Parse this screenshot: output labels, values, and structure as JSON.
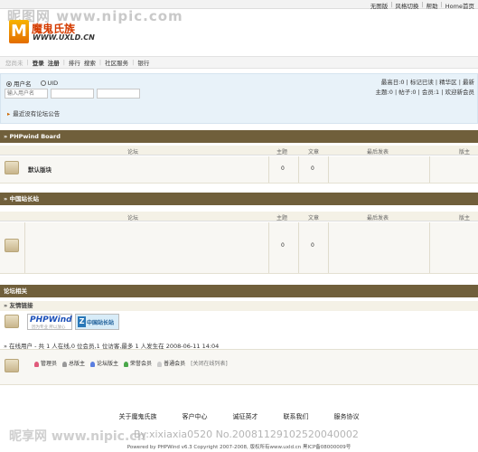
{
  "top_links": [
    "无图版",
    "风格切换",
    "帮助",
    "Home首页"
  ],
  "watermark": "昵图网 www.nipic.com",
  "logo": {
    "mark": "M",
    "name": "魔鬼氏族",
    "domain": "WWW.UXLD.CN"
  },
  "nav": {
    "guest": "您尚未",
    "login": "登录",
    "register": "注册",
    "search_label": "搜索",
    "rank": "排行",
    "community": "社区服务",
    "other": "银行"
  },
  "login": {
    "option_username": "用户名",
    "option_uid": "UID",
    "username_placeholder": "输入用户名",
    "stats_line1": "最高日:0 | 标记已读 | 精华区 | 最新",
    "stats_line2": "主题:0 | 帖子:0 | 会员:1 | 欢迎新会员"
  },
  "notice": "最近没有论坛公告",
  "col_headers": {
    "forum": "论坛",
    "topics": "主题",
    "posts": "文章",
    "last_post": "最后发表",
    "moderator": "版主"
  },
  "boards": [
    {
      "title": "» PHPwind Board",
      "forum_name": "默认版块",
      "topics": "0",
      "posts": "0"
    },
    {
      "title": "» 中国站长站",
      "forum_name": "",
      "topics": "0",
      "posts": "0"
    }
  ],
  "related": {
    "title": "论坛相关",
    "friend_links": "» 友情链接",
    "banner_pw": "PHPWind",
    "banner_pw_sub": "因为专业 所以放心",
    "banner_zg": "中国站长站",
    "online": "» 在线用户 - 共 1 人在线,0 位会员,1 位访客,最多 1 人发生在 2008-06-11 14:04",
    "legend": [
      "管理员",
      "总版主",
      "论坛版主",
      "荣誉会员",
      "普通会员",
      "[关闭在线列表]"
    ]
  },
  "footer": {
    "links": [
      "关于魔鬼氏族",
      "客户中心",
      "诚征英才",
      "联系我们",
      "服务协议"
    ],
    "copyright": "Powered by PHPWind v6.3 Copyright 2007-2008, 版权所有www.uxld.cn 黑ICP备08000009号",
    "watermark_left": "昵享网 www.nipic.cn",
    "watermark_mid": "By:xixiaxia0520 No.20081129102520040002"
  },
  "colors": {
    "board_header": "#705f3b",
    "login_bg": "#e8f2f9",
    "logo_red": "#d43b00"
  }
}
